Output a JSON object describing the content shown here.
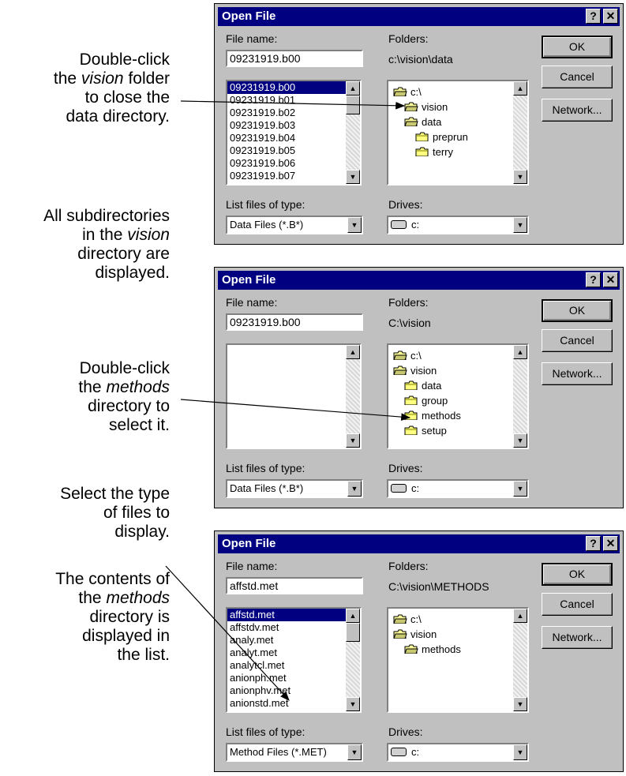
{
  "annotations": [
    {
      "lines": [
        "Double-click",
        "the {i:vision} folder",
        "to close the",
        "data directory."
      ]
    },
    {
      "lines": [
        "All subdirectories",
        "in the {i:vision}",
        "directory are",
        "displayed."
      ]
    },
    {
      "lines": [
        "Double-click",
        "the {i:methods}",
        "directory to",
        "select it."
      ]
    },
    {
      "lines": [
        "Select the type",
        "of files to",
        "display."
      ]
    },
    {
      "lines": [
        "The contents of",
        "the {i:methods}",
        "directory is",
        "displayed in",
        "the list."
      ]
    }
  ],
  "dialogs": [
    {
      "title": "Open File",
      "file_name_label": "File name:",
      "file_name_value": "09231919.b00",
      "folders_label": "Folders:",
      "folders_path": "c:\\vision\\data",
      "files": [
        "09231919.b00",
        "09231919.b01",
        "09231919.b02",
        "09231919.b03",
        "09231919.b04",
        "09231919.b05",
        "09231919.b06",
        "09231919.b07"
      ],
      "selected_file": 0,
      "tree": [
        {
          "label": "c:\\",
          "indent": 0,
          "icon": "open-folder-icon"
        },
        {
          "label": "vision",
          "indent": 1,
          "icon": "open-folder-icon"
        },
        {
          "label": "data",
          "indent": 1,
          "icon": "open-folder-icon"
        },
        {
          "label": "preprun",
          "indent": 2,
          "icon": "folder-icon"
        },
        {
          "label": "terry",
          "indent": 2,
          "icon": "folder-icon"
        }
      ],
      "list_type_label": "List files of type:",
      "list_type_value": "Data Files (*.B*)",
      "drives_label": "Drives:",
      "drives_value": "c:",
      "ok": "OK",
      "cancel": "Cancel",
      "network": "Network..."
    },
    {
      "title": "Open File",
      "file_name_label": "File name:",
      "file_name_value": "09231919.b00",
      "folders_label": "Folders:",
      "folders_path": "C:\\vision",
      "files": [],
      "selected_file": -1,
      "tree": [
        {
          "label": "c:\\",
          "indent": 0,
          "icon": "open-folder-icon"
        },
        {
          "label": "vision",
          "indent": 0,
          "icon": "open-folder-icon"
        },
        {
          "label": "data",
          "indent": 1,
          "icon": "folder-icon"
        },
        {
          "label": "group",
          "indent": 1,
          "icon": "folder-icon"
        },
        {
          "label": "methods",
          "indent": 1,
          "icon": "folder-icon"
        },
        {
          "label": "setup",
          "indent": 1,
          "icon": "folder-icon"
        }
      ],
      "list_type_label": "List files of type:",
      "list_type_value": "Data Files (*.B*)",
      "drives_label": "Drives:",
      "drives_value": "c:",
      "ok": "OK",
      "cancel": "Cancel",
      "network": "Network..."
    },
    {
      "title": "Open File",
      "file_name_label": "File name:",
      "file_name_value": "affstd.met",
      "folders_label": "Folders:",
      "folders_path": "C:\\vision\\METHODS",
      "files": [
        "affstd.met",
        "affstdv.met",
        "analy.met",
        "analyt.met",
        "analytcl.met",
        "anionph.met",
        "anionphv.met",
        "anionstd.met"
      ],
      "selected_file": 0,
      "tree": [
        {
          "label": "c:\\",
          "indent": 0,
          "icon": "open-folder-icon"
        },
        {
          "label": "vision",
          "indent": 0,
          "icon": "open-folder-icon"
        },
        {
          "label": "methods",
          "indent": 1,
          "icon": "open-folder-icon"
        }
      ],
      "list_type_label": "List files of type:",
      "list_type_value": "Method Files (*.MET)",
      "drives_label": "Drives:",
      "drives_value": "c:",
      "ok": "OK",
      "cancel": "Cancel",
      "network": "Network..."
    }
  ],
  "title_buttons": {
    "help": "?",
    "close": "✕"
  },
  "arrow_glyphs": {
    "up": "▲",
    "down": "▼"
  }
}
